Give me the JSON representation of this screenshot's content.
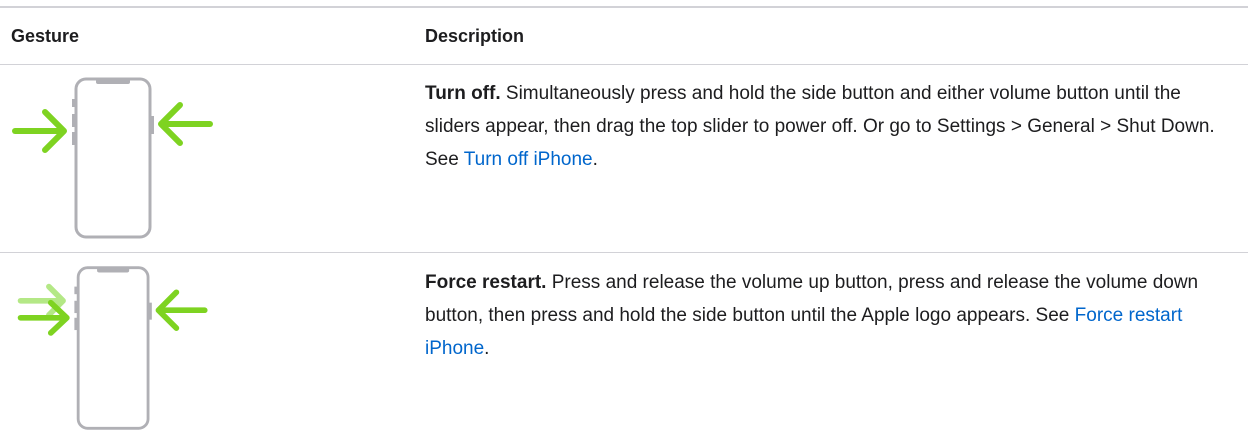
{
  "table": {
    "headers": {
      "gesture": "Gesture",
      "description": "Description"
    },
    "rows": [
      {
        "lead": "Turn off.",
        "body": " Simultaneously press and hold the side button and either volume button until the sliders appear, then drag the top slider to power off. Or go to Settings > General > Shut Down. See ",
        "link": "Turn off iPhone",
        "tail": "."
      },
      {
        "lead": "Force restart.",
        "body": " Press and release the volume up button, press and release the volume down button, then press and hold the side button until the Apple logo appears. See ",
        "link": "Force restart iPhone",
        "tail": "."
      }
    ]
  },
  "colors": {
    "arrow_green": "#7ed321",
    "arrow_green_light": "#b4e886",
    "phone_outline": "#b0b0b5",
    "link": "#0066cc",
    "rule": "#d2d2d7"
  },
  "icons": {
    "row_1": "iphone-turn-off-gesture-icon",
    "row_2": "iphone-force-restart-gesture-icon"
  }
}
